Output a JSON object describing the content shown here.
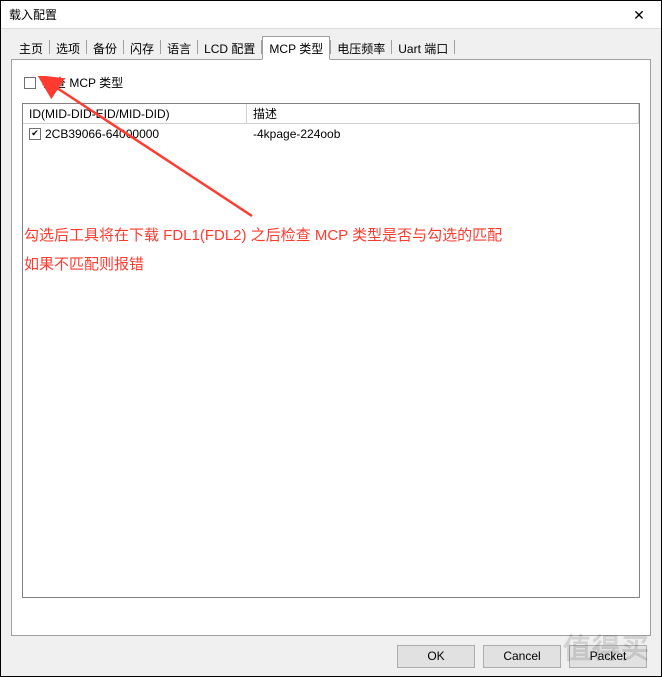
{
  "window": {
    "title": "载入配置"
  },
  "tabs": [
    {
      "label": "主页"
    },
    {
      "label": "选项"
    },
    {
      "label": "备份"
    },
    {
      "label": "闪存"
    },
    {
      "label": "语言"
    },
    {
      "label": "LCD 配置"
    },
    {
      "label": "MCP 类型",
      "active": true
    },
    {
      "label": "电压频率"
    },
    {
      "label": "Uart 端口"
    }
  ],
  "panel": {
    "checkbox_label": "检查 MCP 类型",
    "checkbox_checked": false,
    "columns": {
      "id": "ID(MID-DID-EID/MID-DID)",
      "desc": "描述"
    },
    "rows": [
      {
        "checked": true,
        "id": "2CB39066-64000000",
        "desc": "-4kpage-224oob"
      }
    ]
  },
  "annotation": {
    "line1": "勾选后工具将在下载 FDL1(FDL2) 之后检查 MCP 类型是否与勾选的匹配",
    "line2": "如果不匹配则报错"
  },
  "buttons": {
    "ok": "OK",
    "cancel": "Cancel",
    "packet": "Packet"
  },
  "watermark": "值得买"
}
